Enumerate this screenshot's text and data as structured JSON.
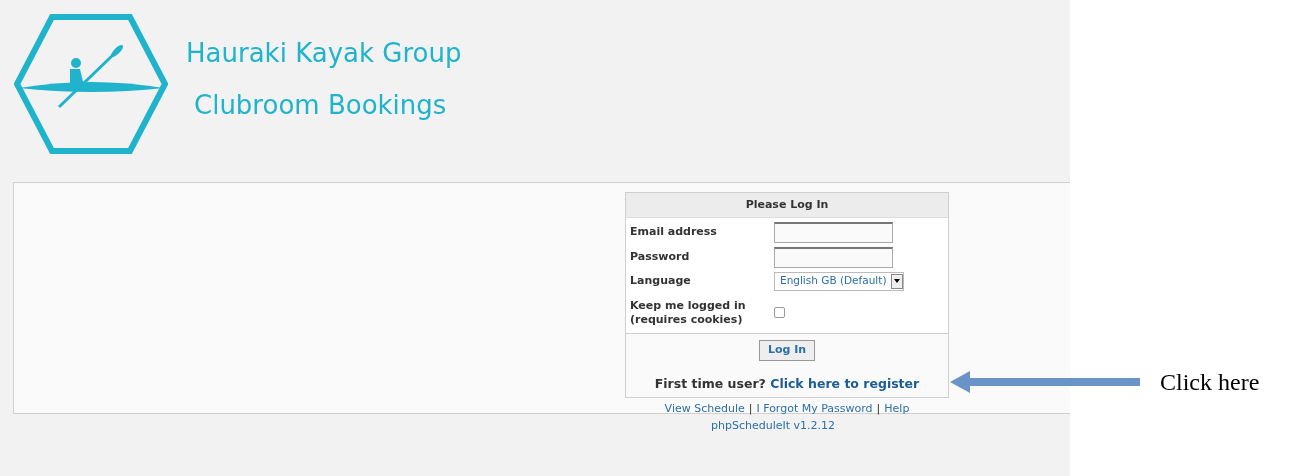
{
  "header": {
    "title": "Hauraki Kayak Group",
    "subtitle": "Clubroom Bookings"
  },
  "login": {
    "title": "Please Log In",
    "fields": [
      {
        "kind": "text",
        "label": "Email address"
      },
      {
        "kind": "password",
        "label": "Password"
      },
      {
        "kind": "select",
        "label": "Language",
        "value": "English GB (Default)"
      },
      {
        "kind": "checkbox",
        "label": "Keep me logged in (requires cookies)",
        "checked": false
      }
    ],
    "button": "Log In",
    "register_prompt": "First time user?",
    "register_link": "Click here to register"
  },
  "links": [
    {
      "kind": "link",
      "text": "View Schedule"
    },
    {
      "kind": "separator",
      "text": "|"
    },
    {
      "kind": "link",
      "text": "I Forgot My Password"
    },
    {
      "kind": "separator",
      "text": "|"
    },
    {
      "kind": "link",
      "text": "Help"
    }
  ],
  "footer": "phpScheduleIt v1.2.12",
  "annotation": {
    "text": "Click here"
  }
}
